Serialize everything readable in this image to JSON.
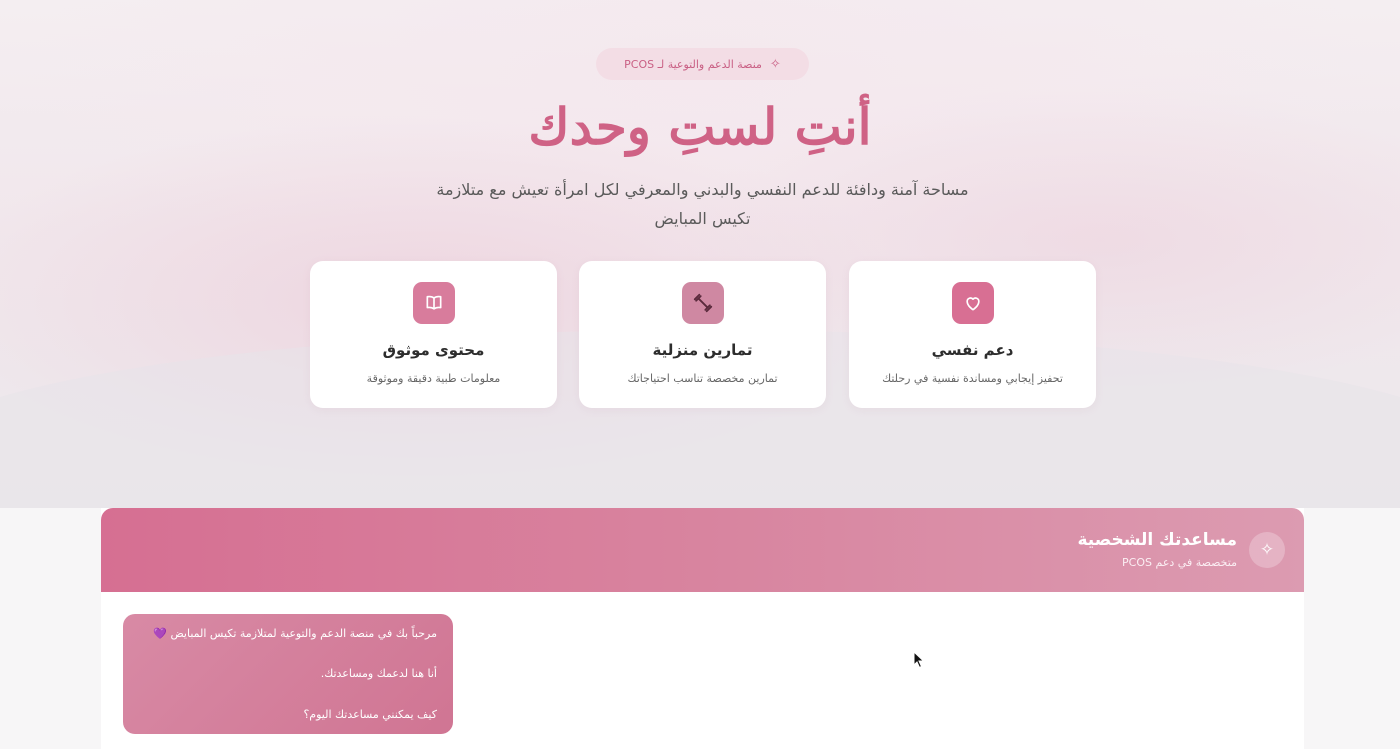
{
  "hero": {
    "badge_icon": "sparkles-icon",
    "badge_text": "منصة الدعم والتوعية لـ PCOS",
    "title": "أنتِ لستِ وحدك",
    "subtitle": "مساحة آمنة ودافئة للدعم النفسي والبدني والمعرفي لكل امرأة تعيش مع متلازمة تكيس المبايض"
  },
  "features": [
    {
      "icon": "heart-icon",
      "title": "دعم نفسي",
      "description": "تحفيز إيجابي ومساندة نفسية في رحلتك"
    },
    {
      "icon": "dumbbell-icon",
      "title": "تمارين منزلية",
      "description": "تمارين مخصصة تناسب احتياجاتك"
    },
    {
      "icon": "book-icon",
      "title": "محتوى موثوق",
      "description": "معلومات طبية دقيقة وموثوقة"
    }
  ],
  "chat": {
    "avatar_icon": "sparkles-icon",
    "title": "مساعدتك الشخصية",
    "subtitle": "متخصصة في دعم PCOS",
    "messages": [
      {
        "sender": "assistant",
        "lines": [
          "مرحباً بك في منصة الدعم والتوعية لمتلازمة تكيس المبايض 💜",
          "أنا هنا لدعمك ومساعدتك.",
          "كيف يمكنني مساعدتك اليوم؟"
        ]
      }
    ]
  },
  "colors": {
    "accent": "#cf6285",
    "header_gradient_start": "#d66f92",
    "header_gradient_end": "#dc9bb1",
    "card_background": "#ffffff"
  }
}
